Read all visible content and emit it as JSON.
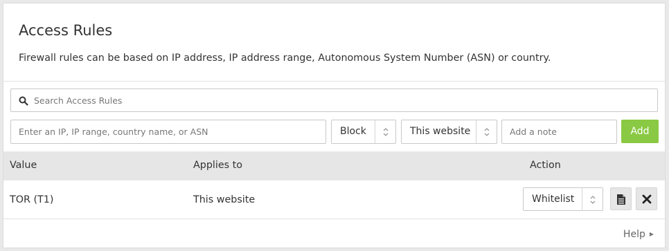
{
  "header": {
    "title": "Access Rules",
    "description": "Firewall rules can be based on IP address, IP address range, Autonomous System Number (ASN) or country."
  },
  "search": {
    "placeholder": "Search Access Rules",
    "icon": "search-icon"
  },
  "form": {
    "value_placeholder": "Enter an IP, IP range, country name, or ASN",
    "action_selected": "Block",
    "scope_selected": "This website",
    "note_placeholder": "Add a note",
    "add_label": "Add"
  },
  "table": {
    "columns": [
      "Value",
      "Applies to",
      "Action"
    ],
    "rows": [
      {
        "value": "TOR (T1)",
        "applies_to": "This website",
        "action": "Whitelist"
      }
    ]
  },
  "footer": {
    "help_label": "Help"
  },
  "colors": {
    "accent_green": "#8ac943",
    "table_header": "#e6e6e6"
  }
}
